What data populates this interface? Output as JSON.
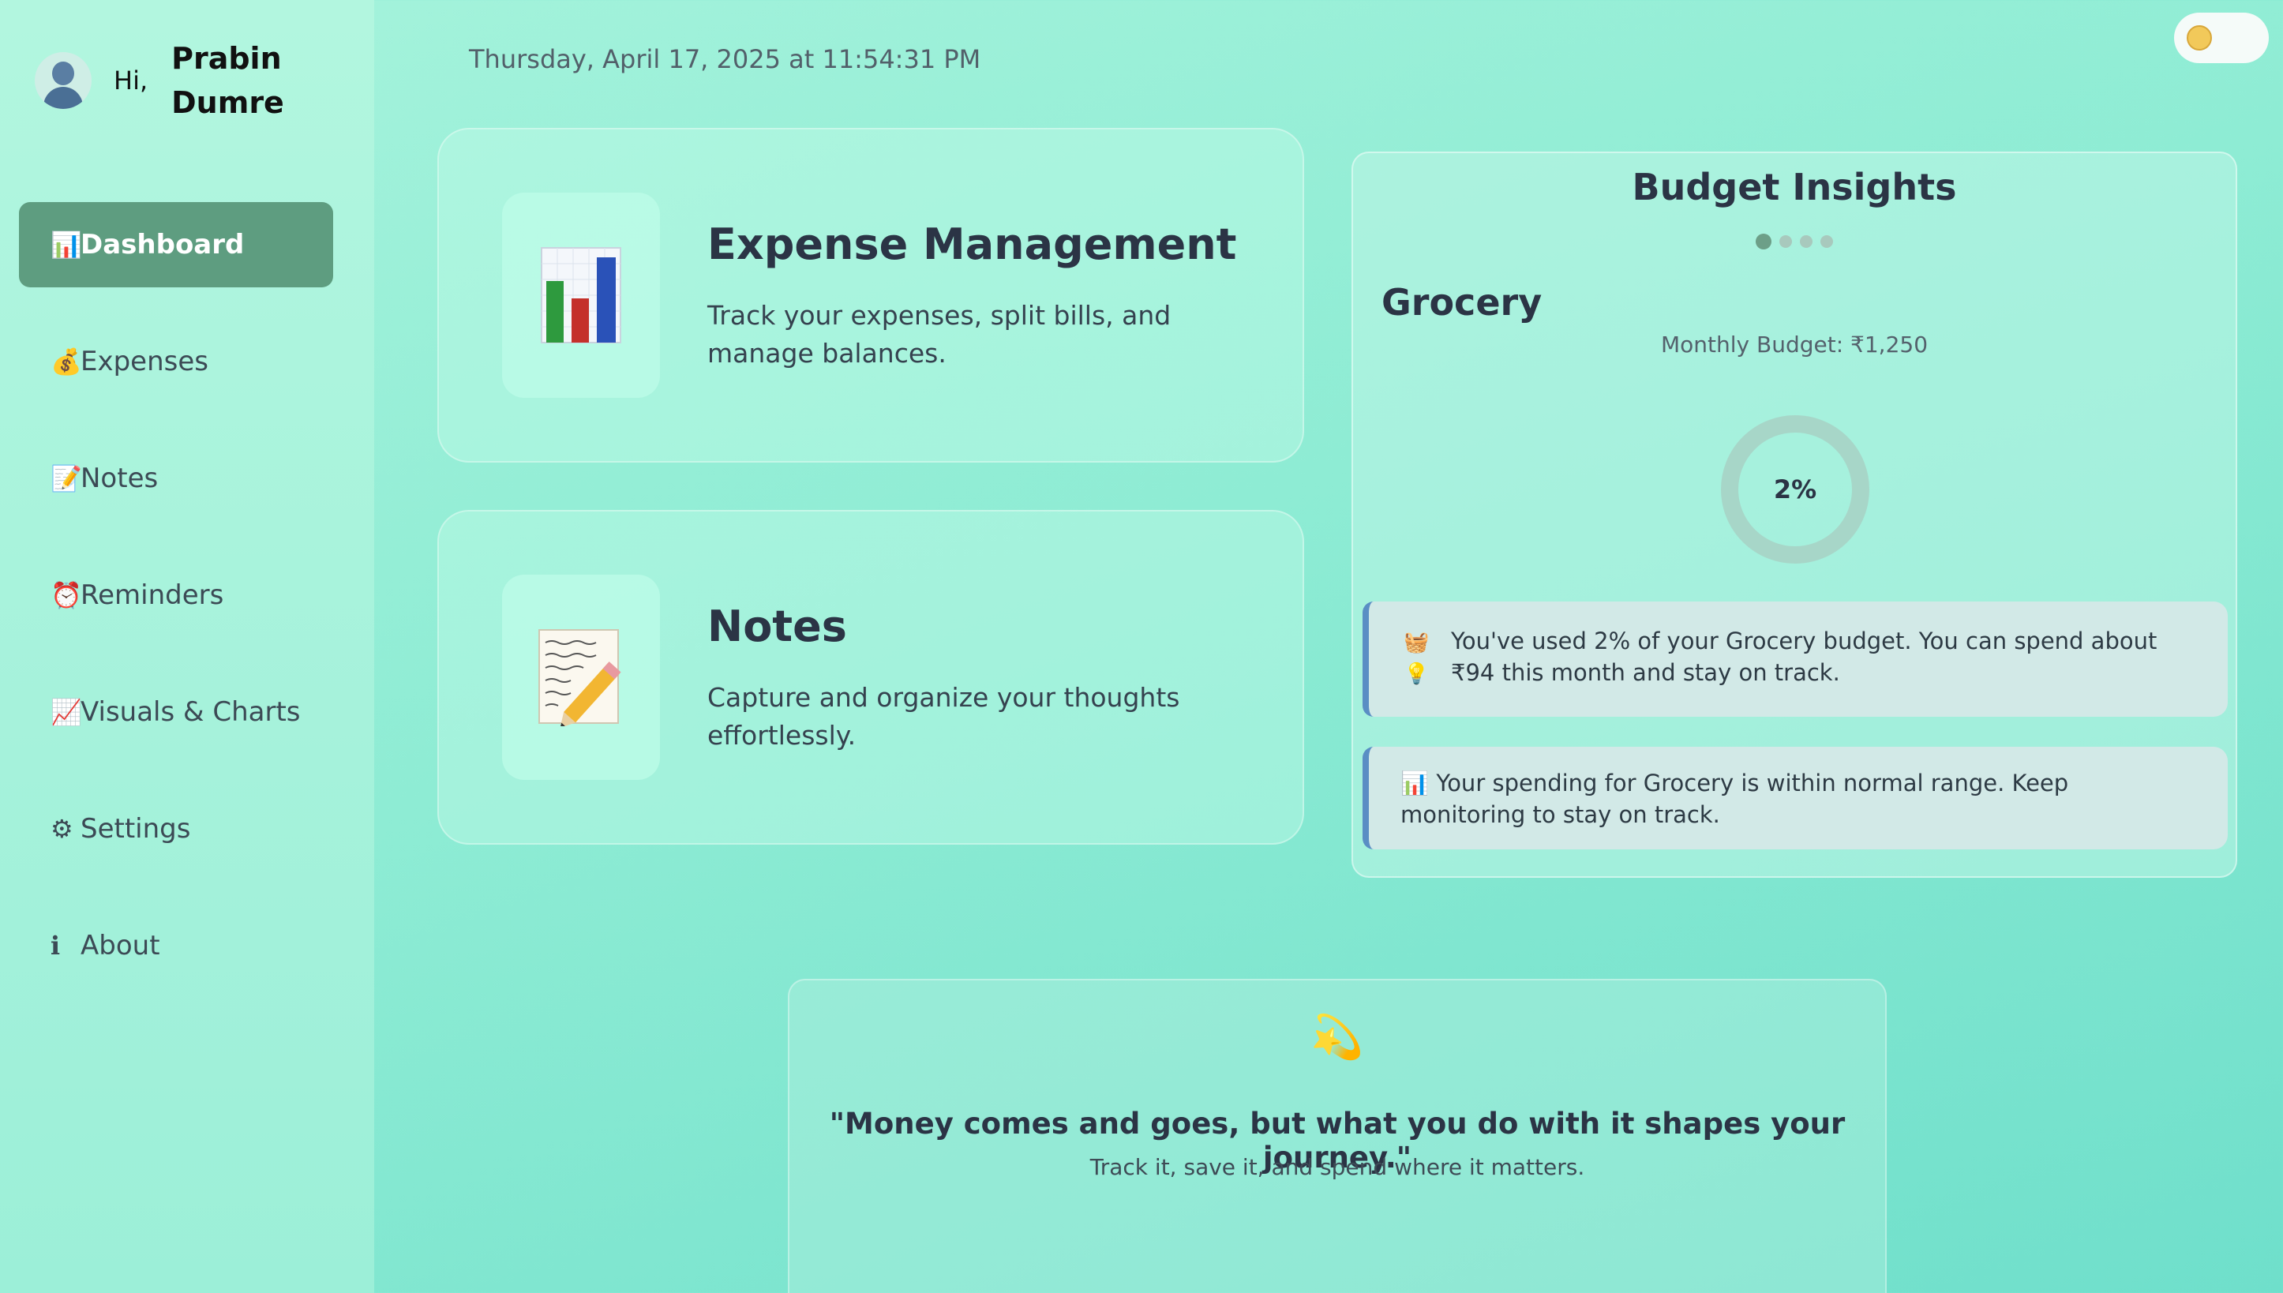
{
  "user": {
    "greeting": "Hi,",
    "name": "Prabin Dumre"
  },
  "sidebar": {
    "items": [
      {
        "icon": "📊",
        "icon_name": "bar-chart-icon",
        "label": "Dashboard",
        "active": true
      },
      {
        "icon": "💰",
        "icon_name": "money-bag-icon",
        "label": "Expenses"
      },
      {
        "icon": "📝",
        "icon_name": "memo-icon",
        "label": "Notes"
      },
      {
        "icon": "⏰",
        "icon_name": "alarm-clock-icon",
        "label": "Reminders"
      },
      {
        "icon": "📈",
        "icon_name": "trend-chart-icon",
        "label": "Visuals & Charts"
      },
      {
        "icon": "⚙",
        "icon_name": "gear-icon",
        "label": "Settings"
      },
      {
        "icon": "ℹ",
        "icon_name": "info-icon",
        "label": "About"
      }
    ]
  },
  "header": {
    "datetime": "Thursday, April 17, 2025 at 11:54:31 PM",
    "theme_toggle_icon": "smiley-sun-icon"
  },
  "cards": {
    "expense": {
      "title": "Expense Management",
      "description": "Track your expenses, split bills, and manage balances.",
      "icon": "bar-chart-document-icon"
    },
    "notes": {
      "title": "Notes",
      "description": "Capture and organize your thoughts effortlessly.",
      "icon": "memo-pencil-icon"
    }
  },
  "insights": {
    "title": "Budget Insights",
    "slide_count": 4,
    "active_slide": 1,
    "category": "Grocery",
    "monthly_budget": "Monthly Budget: ₹1,250",
    "percent_used": "2%",
    "percent_value": 2,
    "tip1_icons": "🧺💡",
    "tip1": "You've used 2% of your Grocery budget. You can spend about ₹94 this month and stay on track.",
    "tip2_icon": "📊",
    "tip2": "Your spending for Grocery is within normal range. Keep monitoring to stay on track."
  },
  "quote": {
    "icon": "💫",
    "text": "\"Money comes and goes, but what you do with it shapes your journey.\"",
    "sub": "Track it, save it, and spend where it matters."
  },
  "colors": {
    "active_nav": "#5e9d80",
    "tip_border": "#5a8ec4",
    "ring": "#a7d6c8"
  }
}
